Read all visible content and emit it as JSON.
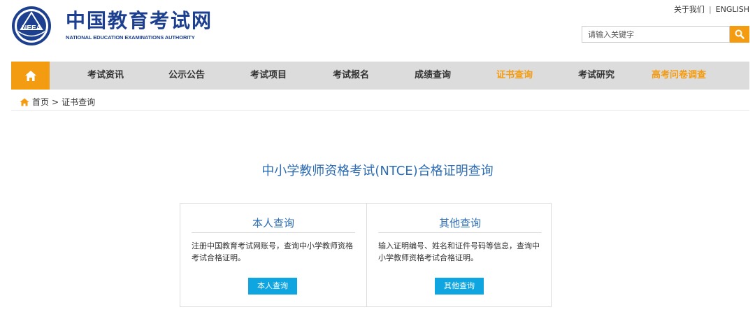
{
  "header": {
    "site_name_cn": "中国教育考试网",
    "site_name_en": "NATIONAL EDUCATION EXAMINATIONS AUTHORITY",
    "logo_text": "NEEA",
    "top_links": [
      "关于我们",
      "ENGLISH"
    ],
    "top_links_separator": "|",
    "search": {
      "placeholder": "请输入关键字"
    },
    "icons": {
      "search_button": "search-icon"
    }
  },
  "nav": {
    "home_icon": "home-icon",
    "items": [
      {
        "label": "考试资讯"
      },
      {
        "label": "公示公告"
      },
      {
        "label": "考试项目"
      },
      {
        "label": "考试报名"
      },
      {
        "label": "成绩查询"
      },
      {
        "label": "证书查询"
      },
      {
        "label": "考试研究"
      },
      {
        "label": "高考问卷调查"
      }
    ],
    "active_color": "#f39c12"
  },
  "breadcrumb": {
    "home": "首页",
    "separator": ">",
    "current": "证书查询"
  },
  "main": {
    "title": "中小学教师资格考试(NTCE)合格证明查询",
    "left": {
      "title": "本人查询",
      "desc": "注册中国教育考试网账号，查询中小学教师资格考试合格证明。",
      "button": "本人查询"
    },
    "right": {
      "title": "其他查询",
      "desc": "输入证明编号、姓名和证件号码等信息，查询中小学教师资格考试合格证明。",
      "button": "其他查询"
    }
  },
  "colors": {
    "brand_blue": "#1c3f8f",
    "accent_orange": "#f39c12",
    "button_blue": "#0ea5e0",
    "title_blue": "#2e6db4"
  }
}
